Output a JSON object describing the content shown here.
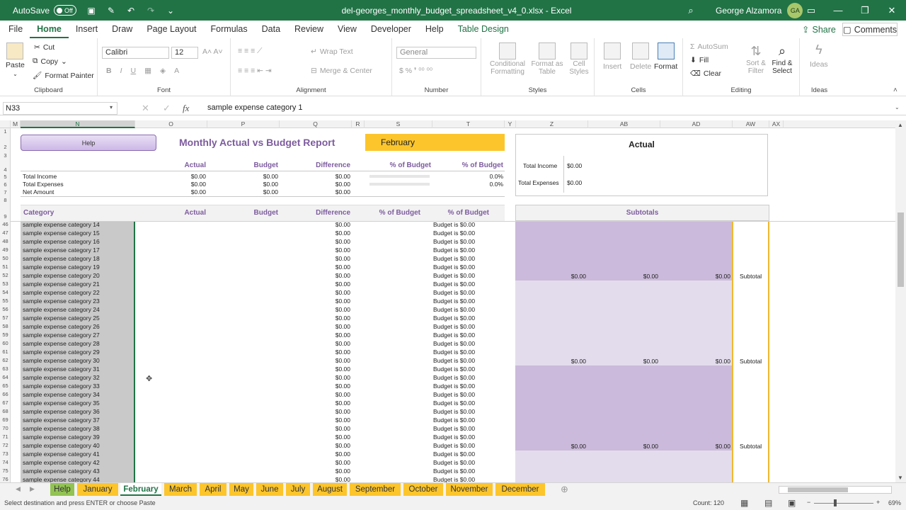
{
  "titlebar": {
    "autosave_label": "AutoSave",
    "autosave_state": "Off",
    "file_title": "del-georges_monthly_budget_spreadsheet_v4_0.xlsx - Excel",
    "user_name": "George Alzamora",
    "user_initials": "GA"
  },
  "menu": {
    "tabs": [
      "File",
      "Home",
      "Insert",
      "Draw",
      "Page Layout",
      "Formulas",
      "Data",
      "Review",
      "View",
      "Developer",
      "Help",
      "Table Design"
    ],
    "active": "Home",
    "share": "Share",
    "comments": "Comments"
  },
  "ribbon": {
    "clipboard": {
      "label": "Clipboard",
      "paste": "Paste",
      "cut": "Cut",
      "copy": "Copy",
      "format_painter": "Format Painter"
    },
    "font": {
      "label": "Font",
      "name": "Calibri",
      "size": "12"
    },
    "alignment": {
      "label": "Alignment",
      "wrap": "Wrap Text",
      "merge": "Merge & Center"
    },
    "number": {
      "label": "Number",
      "format": "General"
    },
    "styles": {
      "label": "Styles",
      "conditional": "Conditional Formatting",
      "format_table": "Format as Table",
      "cell_styles": "Cell Styles"
    },
    "cells": {
      "label": "Cells",
      "insert": "Insert",
      "delete": "Delete",
      "format": "Format"
    },
    "editing": {
      "label": "Editing",
      "autosum": "AutoSum",
      "fill": "Fill",
      "clear": "Clear",
      "sort": "Sort & Filter",
      "find": "Find & Select"
    },
    "ideas": {
      "label": "Ideas",
      "ideas": "Ideas"
    }
  },
  "formula_bar": {
    "name_box": "N33",
    "content": "sample expense category 1",
    "fx": "fx"
  },
  "columns": [
    "M",
    "N",
    "O",
    "P",
    "Q",
    "R",
    "S",
    "T",
    "Y",
    "Z",
    "AB",
    "AD",
    "AW",
    "AX"
  ],
  "rows_top": [
    "1",
    "2",
    "3",
    "4",
    "5",
    "6",
    "7",
    "8",
    "9"
  ],
  "report": {
    "help_button": "Help",
    "title": "Monthly Actual vs Budget Report",
    "month": "February",
    "summary_headers": {
      "actual": "Actual",
      "budget": "Budget",
      "difference": "Difference",
      "pct_bar": "% of Budget",
      "pct": "% of Budget"
    },
    "summary_rows": [
      {
        "label": "Total Income",
        "actual": "$0.00",
        "budget": "$0.00",
        "difference": "$0.00",
        "pct": "0.0%"
      },
      {
        "label": "Total Expenses",
        "actual": "$0.00",
        "budget": "$0.00",
        "difference": "$0.00",
        "pct": "0.0%"
      },
      {
        "label": "Net Amount",
        "actual": "$0.00",
        "budget": "$0.00",
        "difference": "$0.00",
        "pct": ""
      }
    ],
    "actual_panel": {
      "title": "Actual",
      "income_label": "Total Income",
      "income_value": "$0.00",
      "expense_label": "Total Expenses",
      "expense_value": "$0.00"
    },
    "table_headers": {
      "category": "Category",
      "actual": "Actual",
      "budget": "Budget",
      "difference": "Difference",
      "pct_bar": "% of Budget",
      "pct": "% of Budget",
      "subtotals": "Subtotals"
    },
    "rows": [
      {
        "row": "46",
        "category": "sample expense category 14",
        "difference": "$0.00",
        "status": "Budget is $0.00"
      },
      {
        "row": "47",
        "category": "sample expense category 15",
        "difference": "$0.00",
        "status": "Budget is $0.00"
      },
      {
        "row": "48",
        "category": "sample expense category 16",
        "difference": "$0.00",
        "status": "Budget is $0.00"
      },
      {
        "row": "49",
        "category": "sample expense category 17",
        "difference": "$0.00",
        "status": "Budget is $0.00"
      },
      {
        "row": "50",
        "category": "sample expense category 18",
        "difference": "$0.00",
        "status": "Budget is $0.00"
      },
      {
        "row": "51",
        "category": "sample expense category 19",
        "difference": "$0.00",
        "status": "Budget is $0.00"
      },
      {
        "row": "52",
        "category": "sample expense category 20",
        "difference": "$0.00",
        "status": "Budget is $0.00"
      },
      {
        "row": "53",
        "category": "sample expense category 21",
        "difference": "$0.00",
        "status": "Budget is $0.00"
      },
      {
        "row": "54",
        "category": "sample expense category 22",
        "difference": "$0.00",
        "status": "Budget is $0.00"
      },
      {
        "row": "55",
        "category": "sample expense category 23",
        "difference": "$0.00",
        "status": "Budget is $0.00"
      },
      {
        "row": "56",
        "category": "sample expense category 24",
        "difference": "$0.00",
        "status": "Budget is $0.00"
      },
      {
        "row": "57",
        "category": "sample expense category 25",
        "difference": "$0.00",
        "status": "Budget is $0.00"
      },
      {
        "row": "58",
        "category": "sample expense category 26",
        "difference": "$0.00",
        "status": "Budget is $0.00"
      },
      {
        "row": "59",
        "category": "sample expense category 27",
        "difference": "$0.00",
        "status": "Budget is $0.00"
      },
      {
        "row": "60",
        "category": "sample expense category 28",
        "difference": "$0.00",
        "status": "Budget is $0.00"
      },
      {
        "row": "61",
        "category": "sample expense category 29",
        "difference": "$0.00",
        "status": "Budget is $0.00"
      },
      {
        "row": "62",
        "category": "sample expense category 30",
        "difference": "$0.00",
        "status": "Budget is $0.00"
      },
      {
        "row": "63",
        "category": "sample expense category 31",
        "difference": "$0.00",
        "status": "Budget is $0.00"
      },
      {
        "row": "64",
        "category": "sample expense category 32",
        "difference": "$0.00",
        "status": "Budget is $0.00"
      },
      {
        "row": "65",
        "category": "sample expense category 33",
        "difference": "$0.00",
        "status": "Budget is $0.00"
      },
      {
        "row": "66",
        "category": "sample expense category 34",
        "difference": "$0.00",
        "status": "Budget is $0.00"
      },
      {
        "row": "67",
        "category": "sample expense category 35",
        "difference": "$0.00",
        "status": "Budget is $0.00"
      },
      {
        "row": "68",
        "category": "sample expense category 36",
        "difference": "$0.00",
        "status": "Budget is $0.00"
      },
      {
        "row": "69",
        "category": "sample expense category 37",
        "difference": "$0.00",
        "status": "Budget is $0.00"
      },
      {
        "row": "70",
        "category": "sample expense category 38",
        "difference": "$0.00",
        "status": "Budget is $0.00"
      },
      {
        "row": "71",
        "category": "sample expense category 39",
        "difference": "$0.00",
        "status": "Budget is $0.00"
      },
      {
        "row": "72",
        "category": "sample expense category 40",
        "difference": "$0.00",
        "status": "Budget is $0.00"
      },
      {
        "row": "73",
        "category": "sample expense category 41",
        "difference": "$0.00",
        "status": "Budget is $0.00"
      },
      {
        "row": "74",
        "category": "sample expense category 42",
        "difference": "$0.00",
        "status": "Budget is $0.00"
      },
      {
        "row": "75",
        "category": "sample expense category 43",
        "difference": "$0.00",
        "status": "Budget is $0.00"
      },
      {
        "row": "76",
        "category": "sample expense category 44",
        "difference": "$0.00",
        "status": "Budget is $0.00"
      }
    ],
    "subtotals": [
      {
        "z": "$0.00",
        "ab": "$0.00",
        "ad": "$0.00",
        "label": "Subtotal"
      },
      {
        "z": "$0.00",
        "ab": "$0.00",
        "ad": "$0.00",
        "label": "Subtotal"
      },
      {
        "z": "$0.00",
        "ab": "$0.00",
        "ad": "$0.00",
        "label": "Subtotal"
      }
    ]
  },
  "sheet_tabs": [
    "Help",
    "January",
    "February",
    "March",
    "April",
    "May",
    "June",
    "July",
    "August",
    "September",
    "October",
    "November",
    "December"
  ],
  "active_sheet": "February",
  "status": {
    "message": "Select destination and press ENTER or choose Paste",
    "count": "Count: 120",
    "zoom": "69%"
  },
  "colors": {
    "excel_green": "#217346",
    "accent_purple": "#7d5c9e",
    "month_yellow": "#fcc52b",
    "subtotal_purple": "#cbbadb",
    "light_purple": "#e3dced"
  }
}
